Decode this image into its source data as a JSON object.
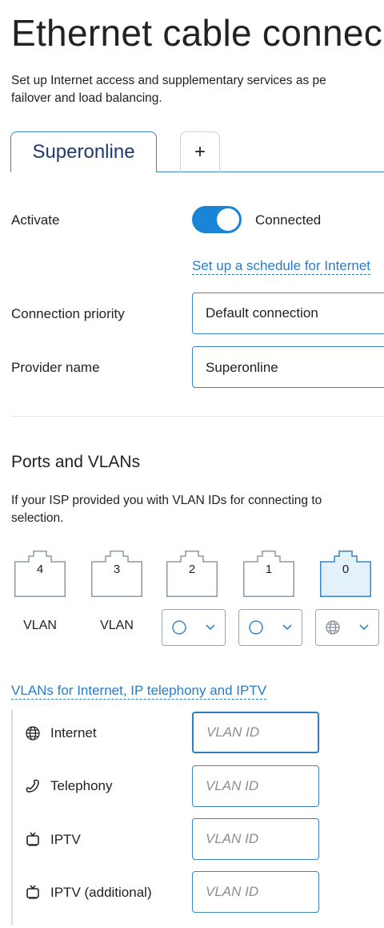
{
  "page": {
    "title": "Ethernet cable connec",
    "description": "Set up Internet access and supplementary services as pe\nfailover and load balancing."
  },
  "tabs": [
    {
      "label": "Superonline",
      "active": true
    },
    {
      "label": "+",
      "active": false
    }
  ],
  "settings": {
    "activate_label": "Activate",
    "activate_state": "Connected",
    "activate_on": true,
    "schedule_link": "Set up a schedule for Internet",
    "priority_label": "Connection priority",
    "priority_value": "Default connection",
    "provider_label": "Provider name",
    "provider_value": "Superonline"
  },
  "ports_section": {
    "heading": "Ports and VLANs",
    "description": "If your ISP provided you with VLAN IDs for connecting to\nselection.",
    "ports": [
      {
        "number": "4",
        "mode_label": "VLAN",
        "mode_icon": "",
        "selected": false
      },
      {
        "number": "3",
        "mode_label": "VLAN",
        "mode_icon": "",
        "selected": false
      },
      {
        "number": "2",
        "mode_label": "",
        "mode_icon": "circle-icon",
        "selected": false
      },
      {
        "number": "1",
        "mode_label": "",
        "mode_icon": "circle-icon",
        "selected": false
      },
      {
        "number": "0",
        "mode_label": "",
        "mode_icon": "globe-icon",
        "selected": true
      }
    ],
    "colors": {
      "port_selected_fill": "#e3f1fb",
      "accent": "#1a85d6"
    }
  },
  "vlans": {
    "link": "VLANs for Internet, IP telephony and IPTV",
    "rows": [
      {
        "icon": "globe-icon",
        "label": "Internet",
        "placeholder": "VLAN ID"
      },
      {
        "icon": "phone-icon",
        "label": "Telephony",
        "placeholder": "VLAN ID"
      },
      {
        "icon": "tv-icon",
        "label": "IPTV",
        "placeholder": "VLAN ID"
      },
      {
        "icon": "tv-icon",
        "label": "IPTV (additional)",
        "placeholder": "VLAN ID"
      }
    ]
  }
}
